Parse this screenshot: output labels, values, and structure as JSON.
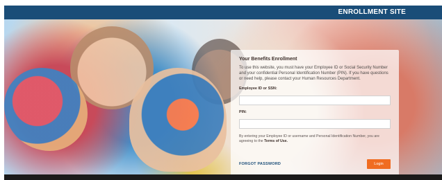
{
  "header": {
    "site_title": "ENROLLMENT SITE"
  },
  "form": {
    "title": "Your Benefits Enrollment",
    "intro": "To use this website, you must have your Employee ID or Social Security Number and your confidential Personal Identification Number (PIN). If you have questions or need help, please contact your Human Resources Department.",
    "employee_id_label": "Employee ID or SSN:",
    "employee_id_value": "",
    "pin_label": "PIN:",
    "pin_value": "",
    "disclaimer_prefix": "By entering your Employee ID or username and Personal Identification Number, you are agreeing to the",
    "terms_link": "Terms of Use.",
    "forgot_link": "FORGOT PASSWORD",
    "login_button": "Login"
  },
  "colors": {
    "header_bg": "#1a4d78",
    "login_button_bg": "#f06c21"
  }
}
